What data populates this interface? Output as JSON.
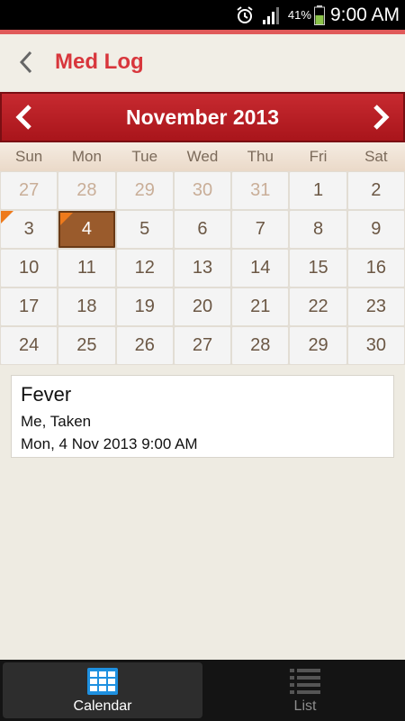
{
  "status_bar": {
    "battery_percent": "41%",
    "time": "9:00 AM",
    "icons": [
      "alarm-icon",
      "signal-icon",
      "battery-icon"
    ]
  },
  "header": {
    "back_icon": "back-chevron-icon",
    "title": "Med Log"
  },
  "calendar": {
    "month_label": "November 2013",
    "weekdays": [
      "Sun",
      "Mon",
      "Tue",
      "Wed",
      "Thu",
      "Fri",
      "Sat"
    ],
    "days": [
      {
        "label": "27",
        "other": true
      },
      {
        "label": "28",
        "other": true
      },
      {
        "label": "29",
        "other": true
      },
      {
        "label": "30",
        "other": true
      },
      {
        "label": "31",
        "other": true
      },
      {
        "label": "1"
      },
      {
        "label": "2"
      },
      {
        "label": "3",
        "marker": true
      },
      {
        "label": "4",
        "marker": true,
        "selected": true
      },
      {
        "label": "5"
      },
      {
        "label": "6"
      },
      {
        "label": "7"
      },
      {
        "label": "8"
      },
      {
        "label": "9"
      },
      {
        "label": "10"
      },
      {
        "label": "11"
      },
      {
        "label": "12"
      },
      {
        "label": "13"
      },
      {
        "label": "14"
      },
      {
        "label": "15"
      },
      {
        "label": "16"
      },
      {
        "label": "17"
      },
      {
        "label": "18"
      },
      {
        "label": "19"
      },
      {
        "label": "20"
      },
      {
        "label": "21"
      },
      {
        "label": "22"
      },
      {
        "label": "23"
      },
      {
        "label": "24"
      },
      {
        "label": "25"
      },
      {
        "label": "26"
      },
      {
        "label": "27"
      },
      {
        "label": "28"
      },
      {
        "label": "29"
      },
      {
        "label": "30"
      }
    ]
  },
  "event": {
    "title": "Fever",
    "subtitle": "Me, Taken",
    "datetime": "Mon, 4 Nov 2013 9:00 AM"
  },
  "bottom_nav": {
    "tabs": [
      {
        "label": "Calendar",
        "icon": "calendar-grid-icon",
        "active": true
      },
      {
        "label": "List",
        "icon": "list-icon",
        "active": false
      }
    ]
  },
  "colors": {
    "accent": "#d8363c",
    "month_bar": "#b71e24",
    "selected_day": "#9a5b2c",
    "marker": "#ee7a1c",
    "calendar_icon": "#1e90e0"
  }
}
